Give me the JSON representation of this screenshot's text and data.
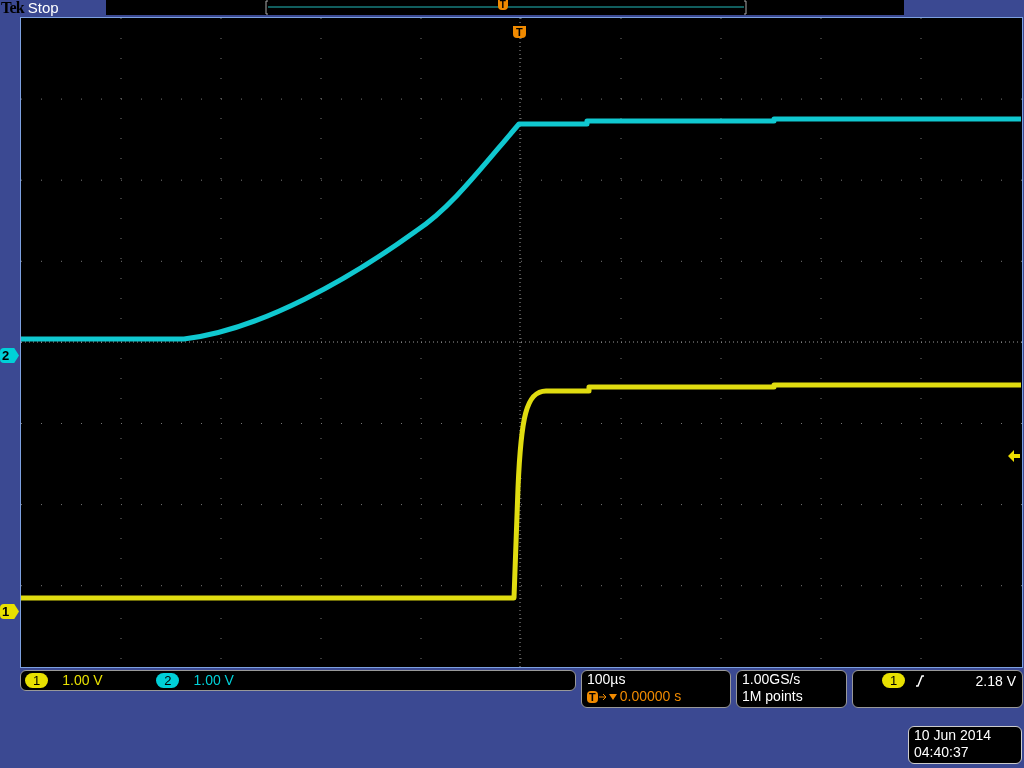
{
  "header": {
    "brand": "Tek",
    "status": "Stop",
    "record_trigger_marker": "T"
  },
  "display": {
    "trigger_marker": "T"
  },
  "channel_markers": [
    {
      "label": "2",
      "color": "#00d0d8"
    },
    {
      "label": "1",
      "color": "#e8e000"
    }
  ],
  "channels": [
    {
      "number": "1",
      "scale": "1.00 V",
      "color": "#e8e000"
    },
    {
      "number": "2",
      "scale": "1.00 V",
      "color": "#00d0d8"
    }
  ],
  "horizontal": {
    "scale": "100µs",
    "trigger_icon": "T",
    "position": "0.00000 s"
  },
  "acquisition": {
    "sample_rate": "1.00GS/s",
    "record_length": "1M points"
  },
  "trigger": {
    "source": "1",
    "level": "2.18 V"
  },
  "timestamp": {
    "date": "10 Jun 2014",
    "time": "04:40:37"
  }
}
